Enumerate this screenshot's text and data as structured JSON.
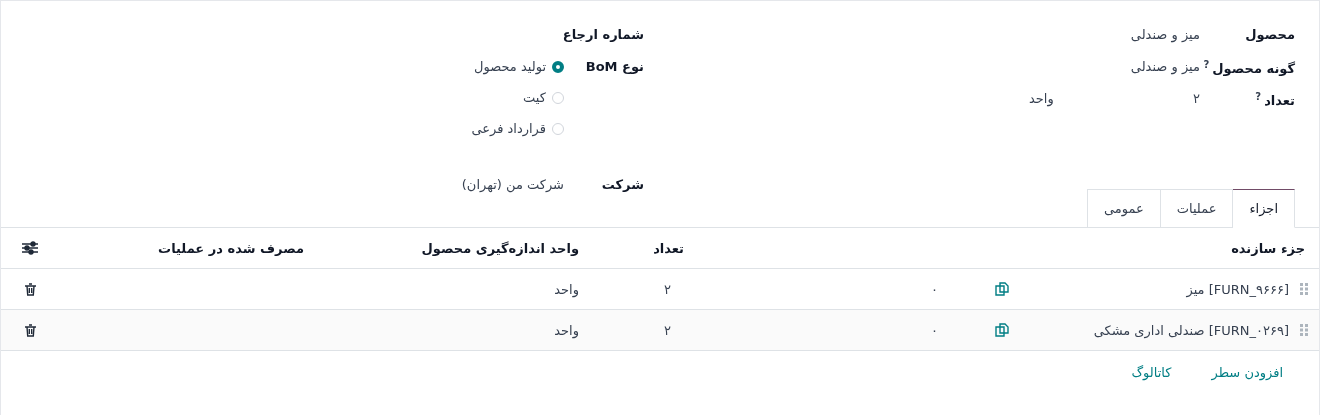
{
  "form": {
    "right_fields": [
      {
        "label": "محصول",
        "value": "میز و صندلی"
      },
      {
        "label": "گونه محصول",
        "help": "?",
        "value": "میز و صندلی"
      },
      {
        "label": "تعداد",
        "help": "?",
        "value": "۲",
        "unit": "واحد"
      }
    ],
    "reference": {
      "label": "شماره ارجاع"
    },
    "bom_type": {
      "label": "نوع BoM",
      "options": [
        {
          "label": "تولید محصول",
          "selected": true
        },
        {
          "label": "کیت",
          "selected": false
        },
        {
          "label": "قرارداد فرعی",
          "selected": false
        }
      ]
    },
    "company": {
      "label": "شرکت",
      "value": "شرکت من (تهران)"
    }
  },
  "tabs": [
    {
      "label": "اجزاء",
      "selected": true
    },
    {
      "label": "عملیات",
      "selected": false
    },
    {
      "label": "عمومی",
      "selected": false
    }
  ],
  "table": {
    "columns": [
      "جزء سازنده",
      "",
      "تعداد",
      "واحد اندازه‌گیری محصول",
      "مصرف شده در عملیات"
    ],
    "rows": [
      {
        "component": "[FURN_۹۶۶۶] میز",
        "column_5": "۰",
        "quantity": "۲",
        "uom": "واحد"
      },
      {
        "component": "[FURN_۰۲۶۹] صندلی اداری مشکی",
        "column_5": "۰",
        "quantity": "۲",
        "uom": "واحد"
      }
    ],
    "actions": [
      "افزودن سطر",
      "کاتالوگ"
    ]
  }
}
